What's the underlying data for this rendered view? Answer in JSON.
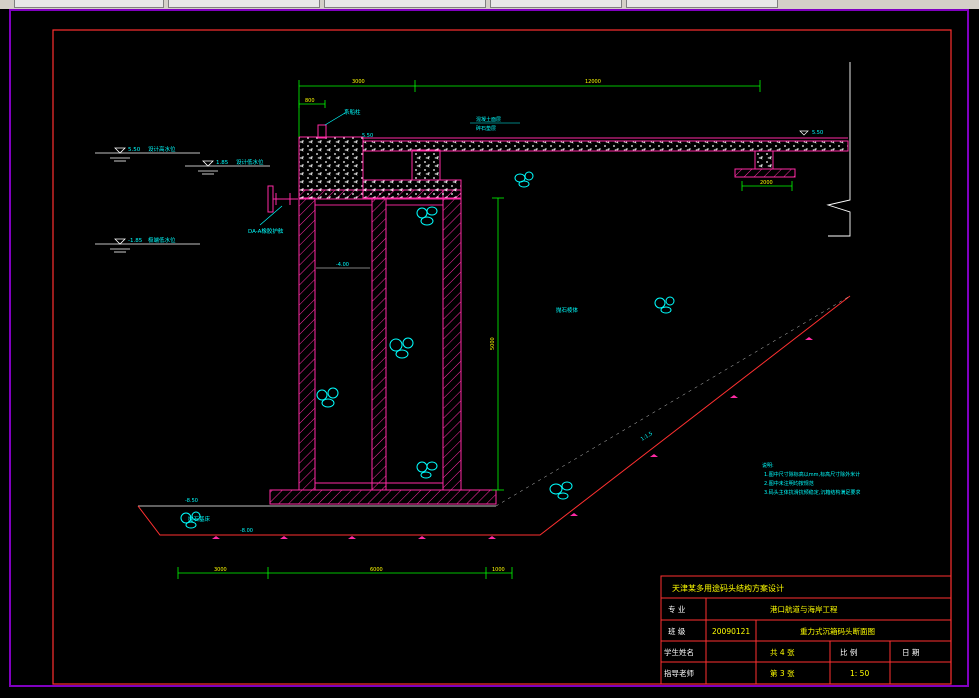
{
  "title_block": {
    "project": "天津某多用途码头结构方案设计",
    "major_label": "专 业",
    "major_value": "港口航道与海岸工程",
    "class_label": "班 级",
    "class_value": "20090121",
    "drawing_name": "重力式沉箱码头断面图",
    "student_label": "学生姓名",
    "advisor_label": "指导老师",
    "sheets_total": "共 4 张",
    "scale_label": "比 例",
    "date_label": "日 期",
    "sheet_no": "第 3 张",
    "scale_value": "1: 50"
  },
  "notes": {
    "heading": "说明:",
    "lines": [
      "1.图中尺寸除标高以mm,标高尺寸除外米计",
      "2.图中未注明均按规范",
      "3.码头主体抗滑抗倾稳定,沉箱结构满足要求"
    ]
  },
  "dimensions": {
    "top_left": "3000",
    "top_main": "12000",
    "small_top": "800",
    "height": "5000",
    "bottom_left": "3000",
    "bottom_main": "6000",
    "bottom_right": "1000",
    "trench": "2000"
  },
  "levels": {
    "design_high": "5.50",
    "design_low": "1.85",
    "extreme_low": "-1.85",
    "crest": "5.50",
    "inner": "-4.00",
    "base": "-8.50",
    "seabed": "-8.00",
    "yard": "5.50"
  },
  "labels": {
    "design_high": "设计高水位",
    "design_low": "设计低水位",
    "extreme_low": "极端低水位",
    "fender": "DA-A橡胶护舷",
    "bollard": "系船柱",
    "pavement": "混凝土面层",
    "pavement2": "碎石垫层",
    "backfill": "抛石棱体",
    "bed": "抛石基床",
    "slope": "1:1.5"
  }
}
